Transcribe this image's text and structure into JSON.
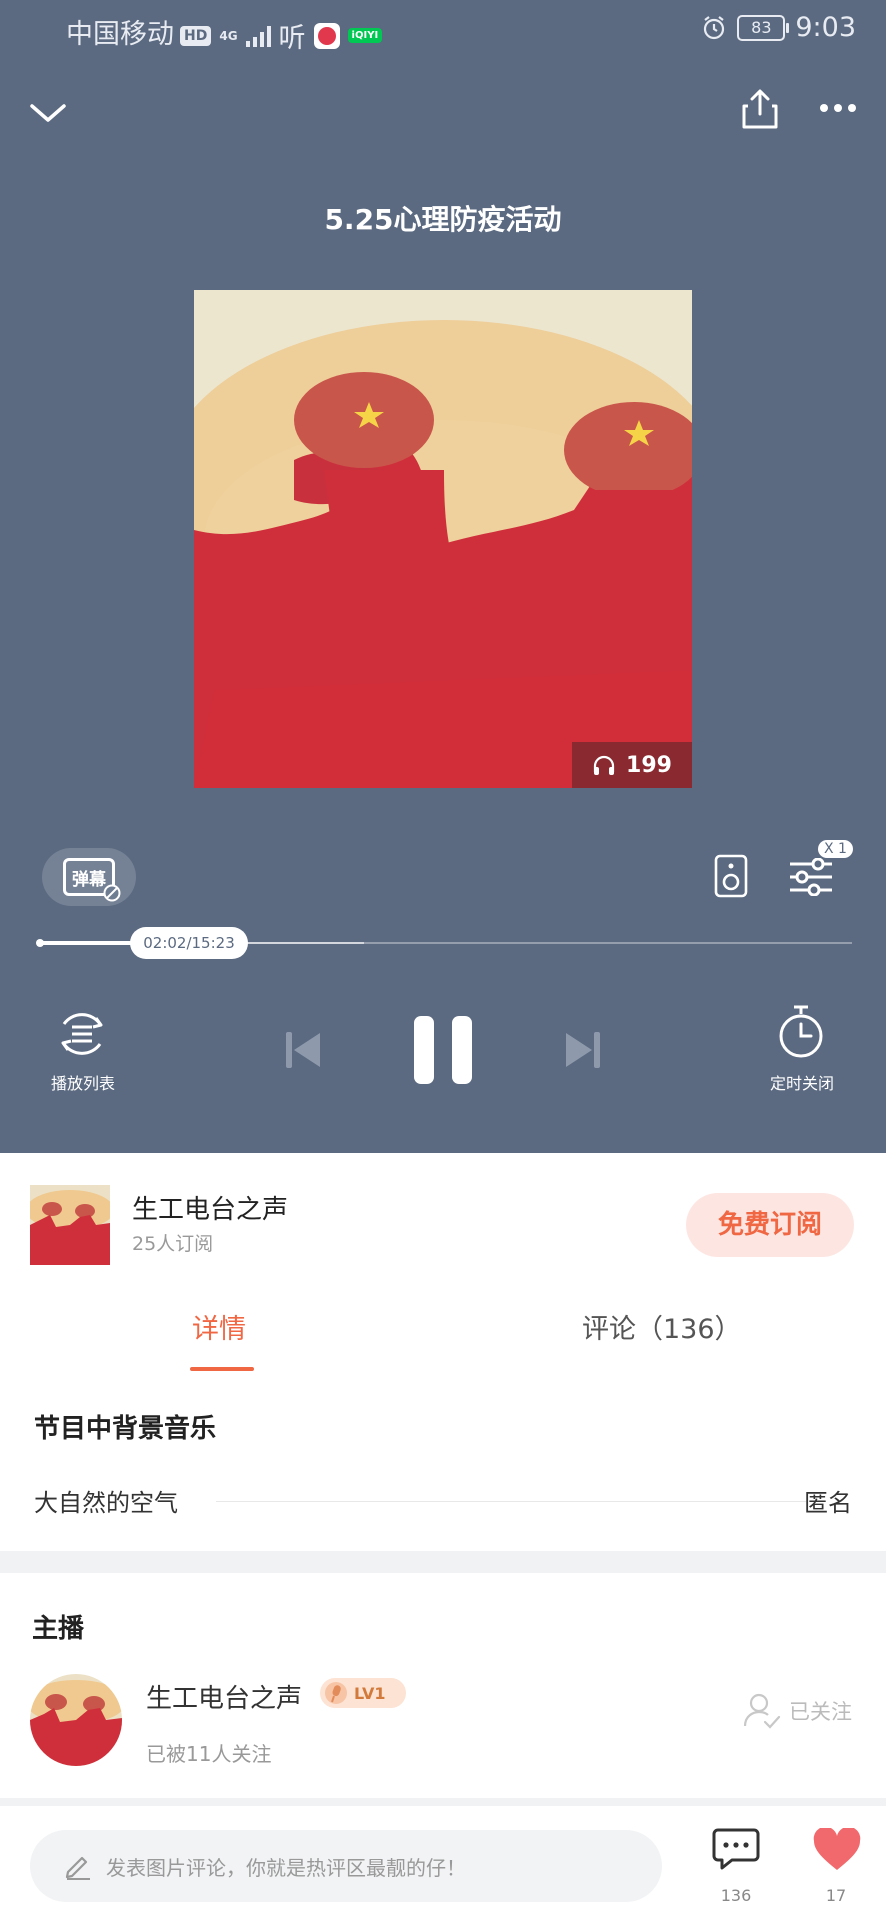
{
  "status_bar": {
    "carrier": "中国移动",
    "hd": "HD",
    "network": "4G",
    "listen_app": "听",
    "iqiyi": "iQIYI",
    "battery": "83",
    "time": "9:03"
  },
  "player": {
    "title": "5.25心理防疫活动",
    "play_count": "199",
    "danmaku_label": "弹幕",
    "speed": "X 1",
    "time": "02:02/15:23",
    "progress_fraction": 0.133,
    "buffer_fraction": 0.4,
    "playlist_label": "播放列表",
    "timer_label": "定时关闭"
  },
  "album": {
    "name": "生工电台之声",
    "subscribers": "25人订阅",
    "subscribe_label": "免费订阅"
  },
  "tabs": {
    "details": "详情",
    "comments": "评论（136）"
  },
  "details": {
    "bgm_title": "节目中背景音乐",
    "bgm_song": "大自然的空气",
    "bgm_artist": "匿名",
    "host_title": "主播",
    "host_name": "生工电台之声",
    "host_level": "LV1",
    "host_followers": "已被11人关注",
    "followed_label": "已关注"
  },
  "bottom": {
    "comment_placeholder": "发表图片评论，你就是热评区最靓的仔！",
    "comment_count": "136",
    "like_count": "17"
  },
  "colors": {
    "player_bg": "#5b6a81",
    "accent": "#f06744",
    "like": "#f1696c"
  }
}
